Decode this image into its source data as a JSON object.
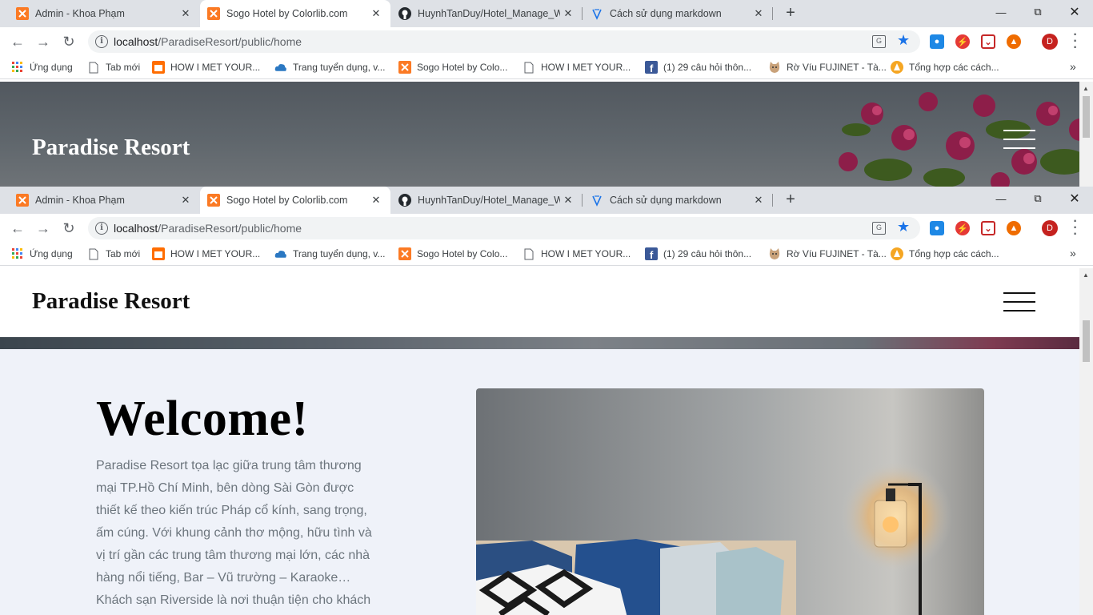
{
  "browser": {
    "tabs": [
      {
        "title": "Admin - Khoa Phạm",
        "icon": "xampp-icon",
        "active": false
      },
      {
        "title": "Sogo Hotel by Colorlib.com",
        "icon": "xampp-icon",
        "active": true
      },
      {
        "title": "HuynhTanDuy/Hotel_Manage_We",
        "icon": "github-icon",
        "active": false
      },
      {
        "title": "Cách sử dụng markdown",
        "icon": "viblo-icon",
        "active": false
      }
    ],
    "url_host": "localhost",
    "url_path": "/ParadiseResort/public/home",
    "profile_initial": "D",
    "bookmarks": [
      {
        "label": "Ứng dụng",
        "icon": "apps-grid-icon"
      },
      {
        "label": "Tab mới",
        "icon": "page-icon"
      },
      {
        "label": "HOW I MET YOUR...",
        "icon": "bookmark-orange-icon"
      },
      {
        "label": "Trang tuyển dụng, v...",
        "icon": "cloud-icon"
      },
      {
        "label": "Sogo Hotel by Colo...",
        "icon": "xampp-icon"
      },
      {
        "label": "HOW I MET YOUR...",
        "icon": "page-icon"
      },
      {
        "label": "(1) 29 câu hỏi thôn...",
        "icon": "facebook-icon"
      },
      {
        "label": "Rờ Víu FUJINET - Tà...",
        "icon": "cat-icon"
      },
      {
        "label": "Tổng hợp các cách...",
        "icon": "triangle-logo-icon"
      }
    ],
    "colors": {
      "tabbar": "#dee1e6",
      "accent": "#1a73e8",
      "xampp": "#fb7a24"
    }
  },
  "site": {
    "brand": "Paradise Resort",
    "welcome_heading": "Welcome!",
    "welcome_text": "Paradise Resort tọa lạc giữa trung tâm thương mại TP.Hồ Chí Minh, bên dòng Sài Gòn được thiết kế theo kiến trúc Pháp cổ kính, sang trọng, ấm cúng. Với khung cảnh thơ mộng, hữu tình và vị trí gần các trung tâm thương mại lớn, các nhà hàng nổi tiếng, Bar – Vũ trường – Karaoke… Khách sạn Riverside là nơi thuận tiện cho khách",
    "colors": {
      "section_bg": "#eff2f9",
      "body_text": "#6c757d"
    }
  }
}
